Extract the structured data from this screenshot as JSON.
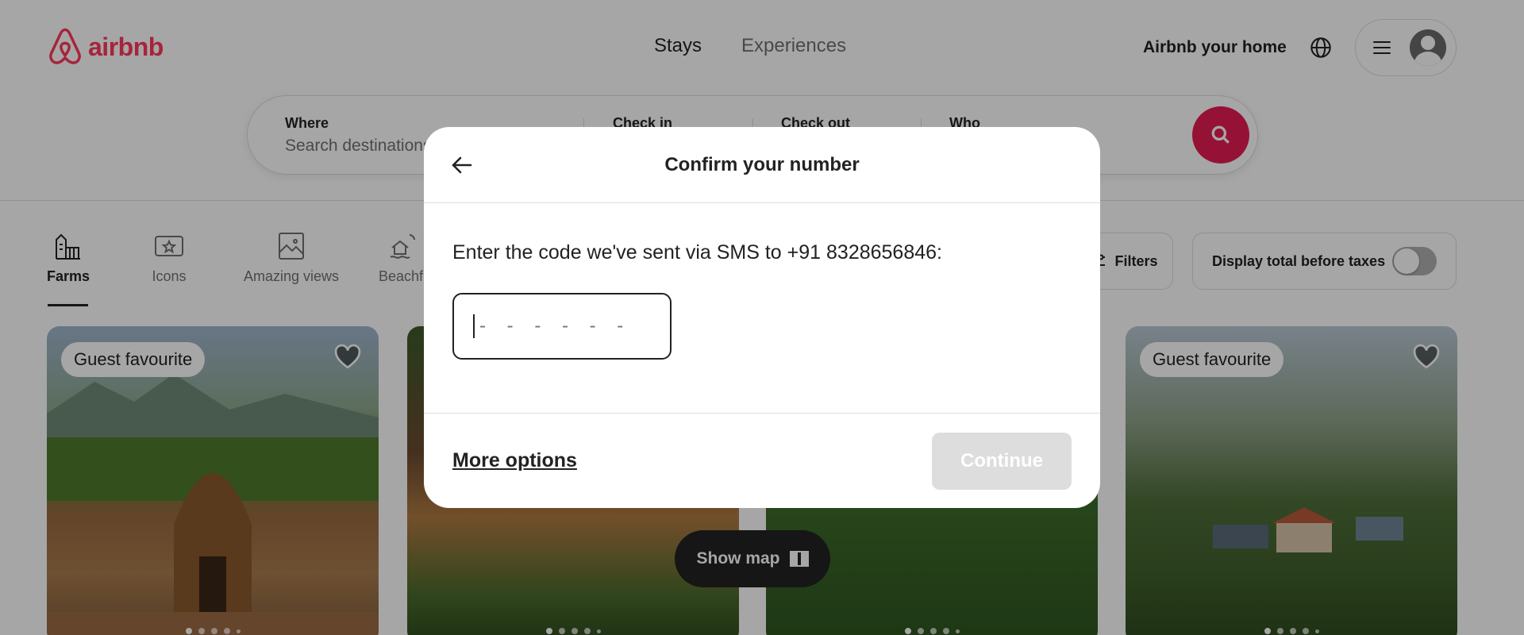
{
  "header": {
    "logo_text": "airbnb",
    "tabs": [
      {
        "label": "Stays",
        "active": true
      },
      {
        "label": "Experiences",
        "active": false
      }
    ],
    "host_link": "Airbnb your home"
  },
  "search": {
    "where_label": "Where",
    "where_placeholder": "Search destinations",
    "checkin_label": "Check in",
    "checkout_label": "Check out",
    "who_label": "Who"
  },
  "categories": [
    {
      "label": "Farms",
      "icon": "farm-icon",
      "active": true
    },
    {
      "label": "Icons",
      "icon": "ticket-star-icon",
      "active": false
    },
    {
      "label": "Amazing views",
      "icon": "picture-frame-icon",
      "active": false
    },
    {
      "label": "Beachfront",
      "icon": "beach-house-icon",
      "active": false
    }
  ],
  "filters": {
    "filters_label": "Filters",
    "tax_toggle_label": "Display total before taxes",
    "tax_toggle_on": false
  },
  "listings": [
    {
      "badge": "Guest favourite",
      "dots": 5
    },
    {
      "badge": "",
      "dots": 5
    },
    {
      "badge": "",
      "dots": 5
    },
    {
      "badge": "Guest favourite",
      "dots": 5
    }
  ],
  "show_map_label": "Show map",
  "modal": {
    "title": "Confirm your number",
    "message": "Enter the code we've sent via SMS to +91 8328656846:",
    "code_placeholder": "- - - - - -",
    "more_options_label": "More options",
    "continue_label": "Continue"
  },
  "colors": {
    "brand": "#ff385c",
    "search_button": "#e51d53",
    "continue_disabled": "#dddddd"
  }
}
